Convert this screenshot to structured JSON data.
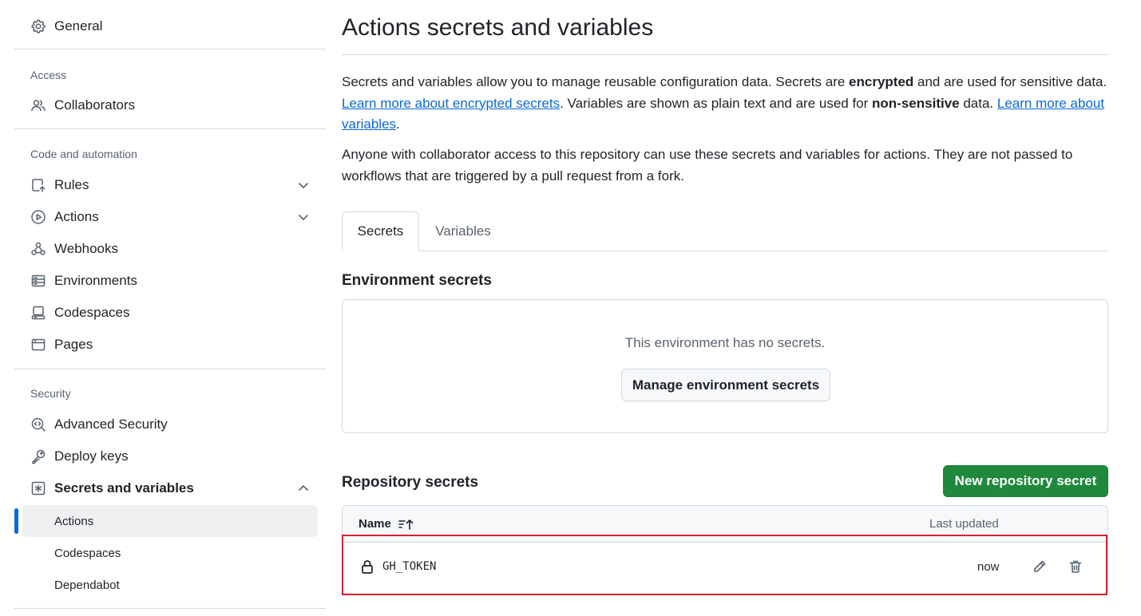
{
  "sidebar": {
    "general": "General",
    "access_heading": "Access",
    "collaborators": "Collaborators",
    "code_heading": "Code and automation",
    "rules": "Rules",
    "actions": "Actions",
    "webhooks": "Webhooks",
    "environments": "Environments",
    "codespaces": "Codespaces",
    "pages": "Pages",
    "security_heading": "Security",
    "advanced_security": "Advanced Security",
    "deploy_keys": "Deploy keys",
    "secrets_and_variables": "Secrets and variables",
    "sub_items": [
      "Actions",
      "Codespaces",
      "Dependabot"
    ],
    "active_sub_item": "Actions"
  },
  "main": {
    "title": "Actions secrets and variables",
    "intro": {
      "t1": "Secrets and variables allow you to manage reusable configuration data. Secrets are ",
      "b1": "encrypted",
      "t2": " and are used for sensitive data. ",
      "link1": "Learn more about encrypted secrets",
      "t3": ". Variables are shown as plain text and are used for ",
      "b2": "non-sensitive",
      "t4": " data. ",
      "link2": "Learn more about variables",
      "t5": "."
    },
    "notice": "Anyone with collaborator access to this repository can use these secrets and variables for actions. They are not passed to workflows that are triggered by a pull request from a fork.",
    "tabs": [
      "Secrets",
      "Variables"
    ],
    "selected_tab": "Secrets",
    "env_secrets": {
      "heading": "Environment secrets",
      "empty_text": "This environment has no secrets.",
      "button": "Manage environment secrets"
    },
    "repo_secrets": {
      "heading": "Repository secrets",
      "new_button": "New repository secret",
      "columns": {
        "name": "Name",
        "last_updated": "Last updated"
      },
      "rows": [
        {
          "name": "GH_TOKEN",
          "updated": "now"
        }
      ]
    }
  },
  "colors": {
    "accent": "#0969da",
    "primary_button": "#1f883d",
    "highlight": "#d1242f"
  }
}
